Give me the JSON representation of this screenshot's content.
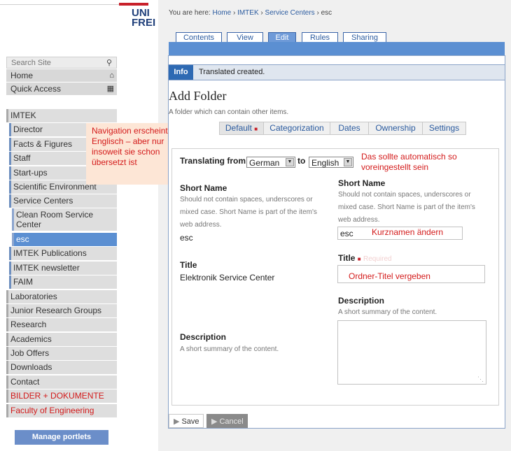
{
  "logo": {
    "line1": "UNI",
    "line2": "FREI"
  },
  "search": {
    "placeholder": "Search Site"
  },
  "nav_top": [
    {
      "label": "Home",
      "icon": "home-icon"
    },
    {
      "label": "Quick Access",
      "icon": "grid-icon"
    }
  ],
  "nav": [
    {
      "label": "IMTEK"
    },
    {
      "label": "Director"
    },
    {
      "label": "Facts & Figures"
    },
    {
      "label": "Staff"
    },
    {
      "label": "Start-ups"
    },
    {
      "label": "Scientific Environment"
    },
    {
      "label": "Service Centers"
    },
    {
      "label": "Clean Room Service Center"
    },
    {
      "label": "esc"
    },
    {
      "label": "IMTEK Publications"
    },
    {
      "label": "IMTEK newsletter"
    },
    {
      "label": "FAIM"
    },
    {
      "label": "Laboratories"
    },
    {
      "label": "Junior Research Groups"
    },
    {
      "label": "Research"
    },
    {
      "label": "Academics"
    },
    {
      "label": "Job Offers"
    },
    {
      "label": "Downloads"
    },
    {
      "label": "Contact"
    },
    {
      "label": "BILDER + DOKUMENTE"
    },
    {
      "label": "Faculty of Engineering"
    }
  ],
  "manage_portlets": "Manage portlets",
  "annotations": {
    "navigation": "Navigation erscheint in Englisch – aber nur insoweit sie schon übersetzt ist",
    "translate": "Das sollte automatisch so voreingestellt sein",
    "shortname": "Kurznamen  ändern",
    "title": "Ordner-Titel  vergeben"
  },
  "breadcrumb": {
    "prefix": "You are here: ",
    "items": [
      "Home",
      "IMTEK",
      "Service Centers",
      "esc"
    ],
    "separator": "›"
  },
  "tabs": [
    "Contents",
    "View",
    "Edit",
    "Rules",
    "Sharing"
  ],
  "info": {
    "label": "Info",
    "message": "Translated created."
  },
  "page_title": "Add Folder",
  "page_description": "A folder which can contain other items.",
  "subtabs": [
    "Default",
    "Categorization",
    "Dates",
    "Ownership",
    "Settings"
  ],
  "translating": {
    "label": "Translating from",
    "from": "German",
    "to_word": "to",
    "to": "English"
  },
  "left_col": {
    "short_name_label": "Short Name",
    "short_name_help": "Should not contain spaces, underscores or mixed case. Short Name is part of the item's web address.",
    "short_name_value": "esc",
    "title_label": "Title",
    "title_value": "Elektronik Service Center",
    "description_label": "Description",
    "description_help": "A short summary of the content."
  },
  "right_col": {
    "short_name_label": "Short Name",
    "short_name_help": "Should not contain spaces, underscores or mixed case. Short Name is part of the item's web address.",
    "short_name_value": "esc",
    "title_label": "Title",
    "title_required": "Required",
    "description_label": "Description",
    "description_help": "A short summary of the content."
  },
  "buttons": {
    "save": "Save",
    "cancel": "Cancel"
  },
  "colors": {
    "accent": "#5b8fd2",
    "annotation_red": "#d31a1a",
    "link": "#2b5b9f"
  }
}
